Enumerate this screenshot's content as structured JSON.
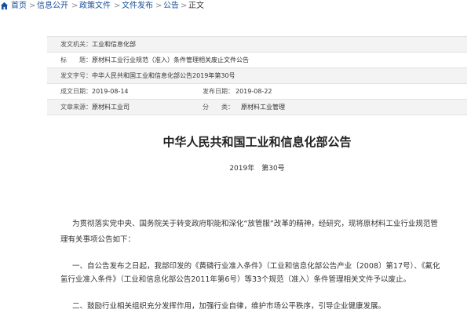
{
  "breadcrumb": {
    "items": [
      "首页",
      "信息公开",
      "政策文件",
      "文件发布",
      "公告",
      "正文"
    ],
    "separator": ">"
  },
  "meta": {
    "issuer_label": "发文机关：",
    "issuer": "工业和信息化部",
    "title_label": "标　　题：",
    "title": "原材料工业行业规范（准入）条件管理相关废止文件公告",
    "docno_label": "发文字号：",
    "docno": "中华人民共和国工业和信息化部公告2019年第30号",
    "created_label": "成文日期：",
    "created": "2019-08-14",
    "published_label": "发布日期：",
    "published": "2019-08-22",
    "source_label": "文章来源：",
    "source": "原材料工业司",
    "category_label": "分　　类：",
    "category": "原材料工业管理"
  },
  "article": {
    "title": "中华人民共和国工业和信息化部公告",
    "number_year": "2019年",
    "number": "第30号",
    "p1_line1": "为贯彻落实党中央、国务院关于转变政府职能和深化“放管服”改革的精神，经研究，现将原材料工业行业规范管",
    "p1_line2": "理有关事项公告如下：",
    "p2_line1": "一、自公告发布之日起，我部印发的《黄磷行业准入条件》（工业和信息化部公告产业〔2008〕第17号）、《氟化",
    "p2_line2": "氢行业准入条件》（工业和信息化部公告2011年第6号）等33个规范（准入）条件管理相关文件予以废止。",
    "p3_line1": "二、鼓励行业相关组织充分发挥作用，加强行业自律，维护市场公平秩序，引导企业健康发展。"
  }
}
